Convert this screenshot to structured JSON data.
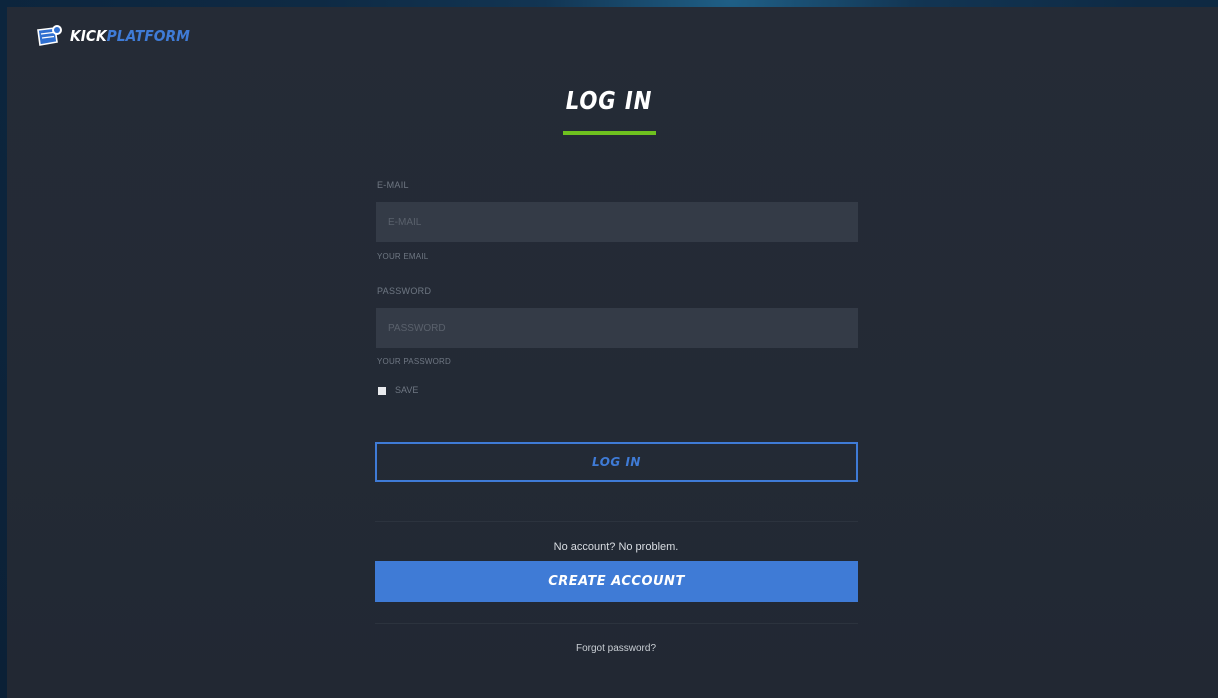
{
  "brand": {
    "name_part1": "KICK",
    "name_part2": "PLATFORM",
    "accent_color": "#3f7bd6",
    "highlight_color": "#6ec11f"
  },
  "page": {
    "title": "LOG IN"
  },
  "form": {
    "email": {
      "label": "E-MAIL",
      "placeholder": "E-MAIL",
      "value": "",
      "hint": "YOUR EMAIL"
    },
    "password": {
      "label": "PASSWORD",
      "placeholder": "PASSWORD",
      "value": "",
      "hint": "YOUR PASSWORD"
    },
    "save": {
      "label": "SAVE",
      "checked": false
    },
    "login_button": "LOG IN"
  },
  "signup": {
    "prompt": "No account? No problem.",
    "create_button": "CREATE ACCOUNT"
  },
  "forgot_link": "Forgot password?"
}
